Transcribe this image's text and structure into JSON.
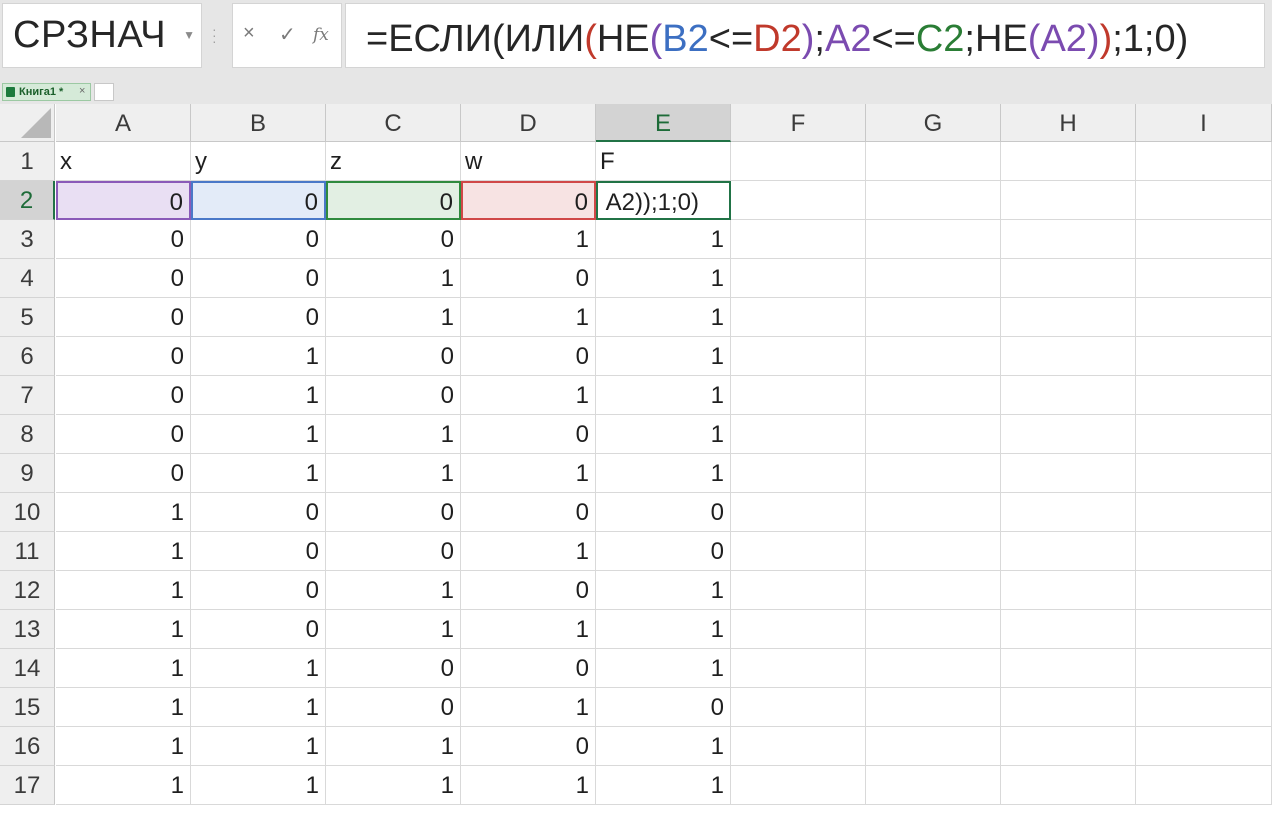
{
  "name_box": {
    "value": "СРЗНАЧ"
  },
  "formula_bar": {
    "cancel_symbol": "×",
    "enter_symbol": "✓",
    "fx_symbol": "fx",
    "tokens": [
      {
        "text": "=ЕСЛИ(ИЛИ",
        "color": "#262626"
      },
      {
        "text": "(",
        "color": "#c0392b"
      },
      {
        "text": "НЕ",
        "color": "#262626"
      },
      {
        "text": "(",
        "color": "#7b4bb0"
      },
      {
        "text": "B2",
        "color": "#3c6fc2"
      },
      {
        "text": "<=",
        "color": "#262626"
      },
      {
        "text": "D2",
        "color": "#c0392b"
      },
      {
        "text": ")",
        "color": "#7b4bb0"
      },
      {
        "text": ";",
        "color": "#262626"
      },
      {
        "text": "A2",
        "color": "#7b4bb0"
      },
      {
        "text": "<=",
        "color": "#262626"
      },
      {
        "text": "C2",
        "color": "#2a7d35"
      },
      {
        "text": ";НЕ",
        "color": "#262626"
      },
      {
        "text": "(",
        "color": "#7b4bb0"
      },
      {
        "text": "A2",
        "color": "#7b4bb0"
      },
      {
        "text": ")",
        "color": "#7b4bb0"
      },
      {
        "text": ")",
        "color": "#c0392b"
      },
      {
        "text": ";1;0)",
        "color": "#262626"
      }
    ]
  },
  "sheet_tab": {
    "label": "Книга1 *",
    "close": "×"
  },
  "columns": [
    "A",
    "B",
    "C",
    "D",
    "E",
    "F",
    "G",
    "H",
    "I"
  ],
  "active_column": "E",
  "active_row": "2",
  "headers_row": [
    "x",
    "y",
    "z",
    "w",
    "F"
  ],
  "editing_cell_text": "A2));1;0)",
  "rows": [
    {
      "row": "1"
    },
    {
      "row": "2",
      "values": [
        "0",
        "0",
        "0",
        "0"
      ]
    },
    {
      "row": "3",
      "values": [
        "0",
        "0",
        "0",
        "1",
        "1"
      ]
    },
    {
      "row": "4",
      "values": [
        "0",
        "0",
        "1",
        "0",
        "1"
      ]
    },
    {
      "row": "5",
      "values": [
        "0",
        "0",
        "1",
        "1",
        "1"
      ]
    },
    {
      "row": "6",
      "values": [
        "0",
        "1",
        "0",
        "0",
        "1"
      ]
    },
    {
      "row": "7",
      "values": [
        "0",
        "1",
        "0",
        "1",
        "1"
      ]
    },
    {
      "row": "8",
      "values": [
        "0",
        "1",
        "1",
        "0",
        "1"
      ]
    },
    {
      "row": "9",
      "values": [
        "0",
        "1",
        "1",
        "1",
        "1"
      ]
    },
    {
      "row": "10",
      "values": [
        "1",
        "0",
        "0",
        "0",
        "0"
      ]
    },
    {
      "row": "11",
      "values": [
        "1",
        "0",
        "0",
        "1",
        "0"
      ]
    },
    {
      "row": "12",
      "values": [
        "1",
        "0",
        "1",
        "0",
        "1"
      ]
    },
    {
      "row": "13",
      "values": [
        "1",
        "0",
        "1",
        "1",
        "1"
      ]
    },
    {
      "row": "14",
      "values": [
        "1",
        "1",
        "0",
        "0",
        "1"
      ]
    },
    {
      "row": "15",
      "values": [
        "1",
        "1",
        "0",
        "1",
        "0"
      ]
    },
    {
      "row": "16",
      "values": [
        "1",
        "1",
        "1",
        "0",
        "1"
      ]
    },
    {
      "row": "17",
      "values": [
        "1",
        "1",
        "1",
        "1",
        "1"
      ]
    }
  ]
}
